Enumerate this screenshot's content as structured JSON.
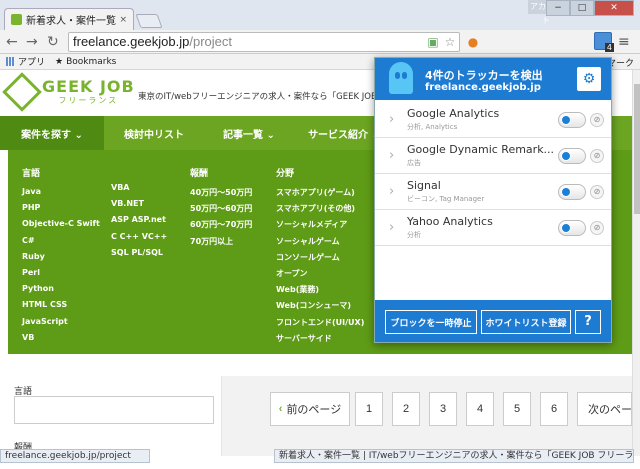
{
  "browser": {
    "tab_title": "新着求人・案件一覧 | IT/w",
    "tab_close": "×",
    "account_label": "アカウント",
    "win_min": "−",
    "win_max": "□",
    "win_close": "✕",
    "url_host": "freelance.geekjob.jp",
    "url_path": "/project",
    "ghostery_badge": "4",
    "bookmarks": [
      "アプリ",
      "Bookmarks"
    ],
    "bookmarks_right": "マーク"
  },
  "site": {
    "logo_text": "GEEK JOB",
    "logo_sub": "フリーランス",
    "tagline": "東京のIT/webフリーエンジニアの求人・案件なら「GEEK JOB フリーランス",
    "nav": [
      "案件を探す ⌄",
      "検討中リスト",
      "記事一覧 ⌄",
      "サービス紹介 ⌄"
    ],
    "menu": {
      "languages_head": "言語",
      "languages_col1": [
        "Java",
        "PHP",
        "Objective-C Swift",
        "C#",
        "Ruby",
        "Perl",
        "Python",
        "HTML CSS",
        "JavaScript",
        "VB"
      ],
      "languages_col2": [
        "VBA",
        "VB.NET",
        "ASP ASP.net",
        "C C++ VC++",
        "SQL PL/SQL"
      ],
      "reward_head": "報酬",
      "rewards": [
        "40万円〜50万円",
        "50万円〜60万円",
        "60万円〜70万円",
        "70万円以上"
      ],
      "field_head": "分野",
      "fields": [
        "スマホアプリ(ゲーム)",
        "スマホアプリ(その他)",
        "ソーシャルメディア",
        "ソーシャルゲーム",
        "コンソールゲーム",
        "オープン",
        "Web(業務)",
        "Web(コンシューマ)",
        "フロントエンド(UI/UX)",
        "サーバーサイド"
      ]
    },
    "filter_label": "言語",
    "filter_label2": "報酬",
    "pagination": {
      "prev": "前のページ",
      "pages": [
        "1",
        "2",
        "3",
        "4",
        "5",
        "6"
      ],
      "next": "次のページ"
    }
  },
  "ghostery": {
    "title": "4件のトラッカーを検出",
    "site": "freelance.geekjob.jp",
    "trackers": [
      {
        "name": "Google Analytics",
        "category": "分析, Analytics"
      },
      {
        "name": "Google Dynamic Remark...",
        "category": "広告"
      },
      {
        "name": "Signal",
        "category": "ビーコン, Tag Manager"
      },
      {
        "name": "Yahoo Analytics",
        "category": "分析"
      }
    ],
    "pause_label": "ブロックを一時停止",
    "whitelist_label": "ホワイトリスト登録",
    "help_label": "?"
  },
  "status": {
    "left": "freelance.geekjob.jp/project",
    "right": "新着求人・案件一覧 | IT/webフリーエンジニアの求人・案件なら「GEEK JOB フリーランス」"
  }
}
